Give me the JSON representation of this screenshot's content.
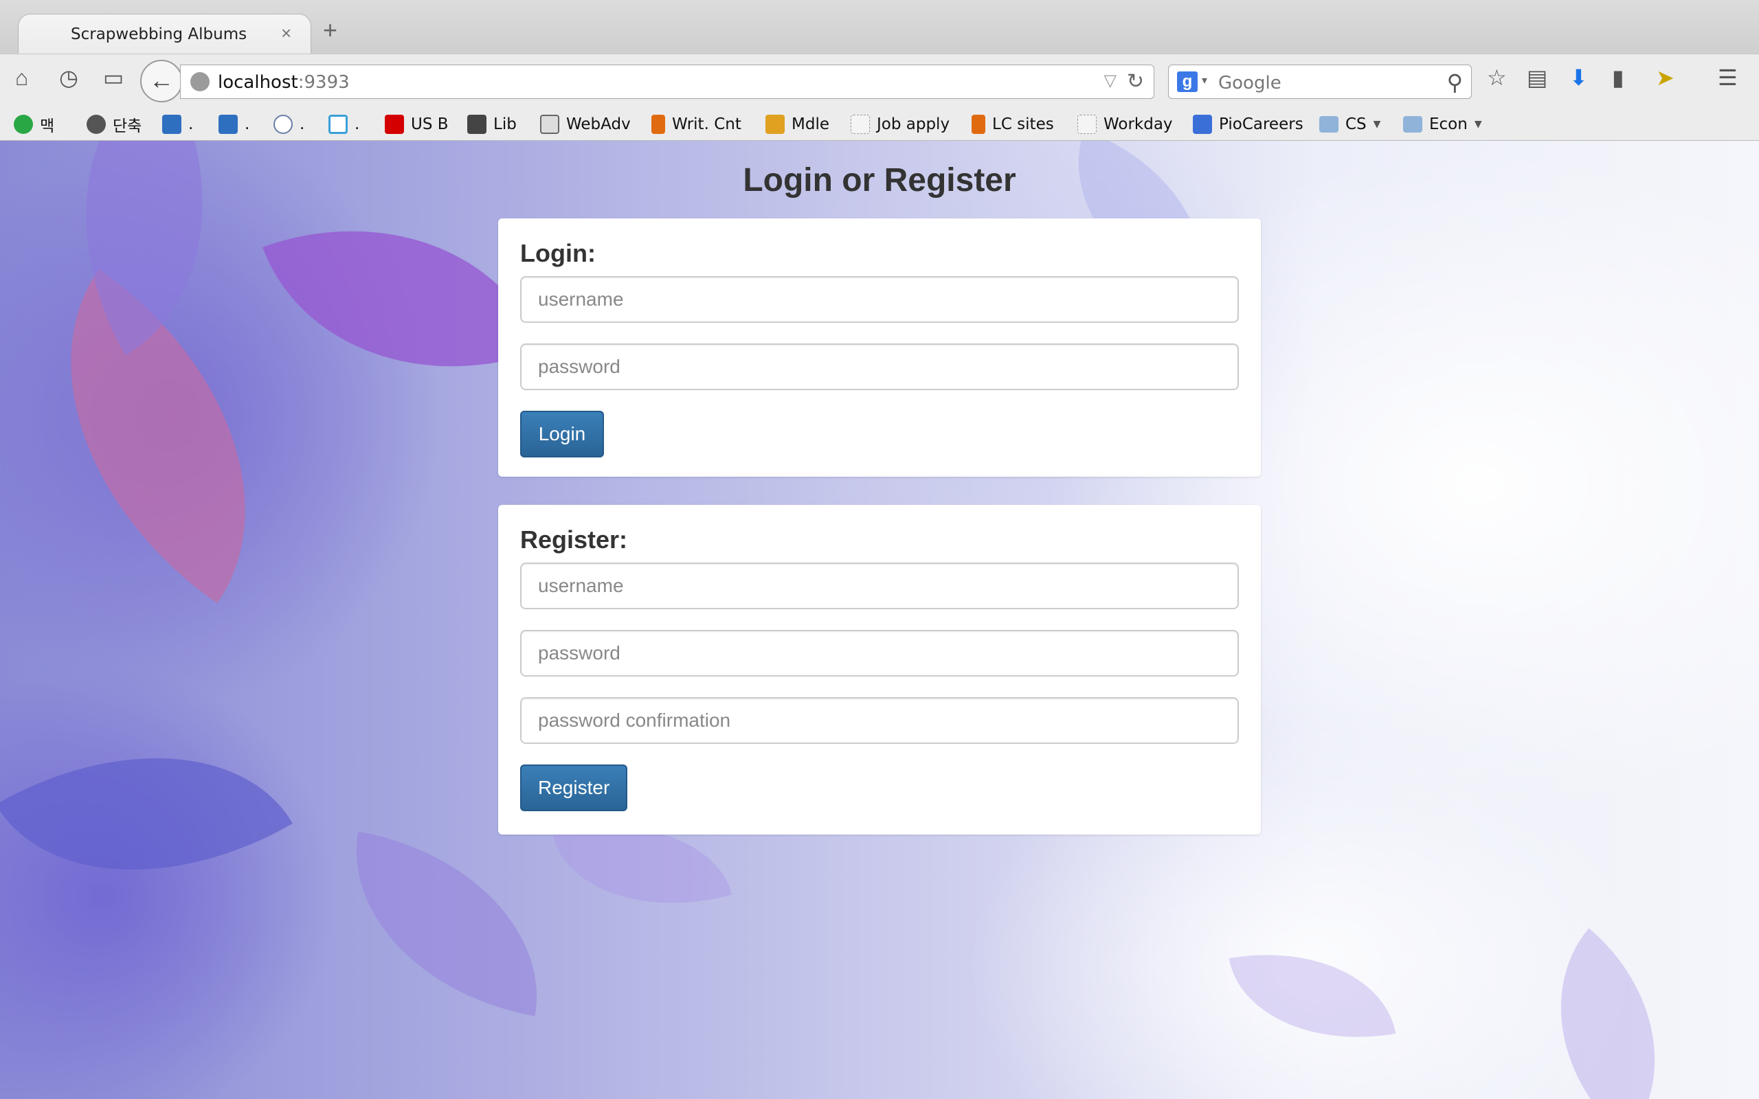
{
  "browser": {
    "tab_title": "Scrapwebbing Albums",
    "tab_close": "×",
    "new_tab": "+",
    "url_host": "localhost",
    "url_port": ":9393",
    "search_engine": "Google",
    "bookmarks": [
      {
        "label": "맥",
        "icon_color": "#2aa745"
      },
      {
        "label": "단축",
        "icon_color": "#555555"
      },
      {
        "label": ".",
        "icon_color": "#2f6fc0"
      },
      {
        "label": ".",
        "icon_color": "#2f6fc0"
      },
      {
        "label": ".",
        "icon_color": "#6b7fa8"
      },
      {
        "label": ".",
        "icon_color": "#3aa0d8"
      },
      {
        "label": "US B",
        "icon_color": "#d40000"
      },
      {
        "label": "Lib",
        "icon_color": "#444444"
      },
      {
        "label": "WebAdv",
        "icon_color": "#666666"
      },
      {
        "label": "Writ. Cnt",
        "icon_color": "#e06a10"
      },
      {
        "label": "Mdle",
        "icon_color": "#e0a020"
      },
      {
        "label": "Job apply",
        "icon_color": "#dddddd"
      },
      {
        "label": "LC sites",
        "icon_color": "#e06a10"
      },
      {
        "label": "Workday",
        "icon_color": "#dddddd"
      },
      {
        "label": "PioCareers",
        "icon_color": "#3b6fd8"
      },
      {
        "label": "CS",
        "icon_color": "#8fb3d9",
        "folder": true
      },
      {
        "label": "Econ",
        "icon_color": "#8fb3d9",
        "folder": true
      }
    ]
  },
  "page": {
    "heading": "Login or Register",
    "login": {
      "title": "Login:",
      "username_placeholder": "username",
      "password_placeholder": "password",
      "button": "Login"
    },
    "register": {
      "title": "Register:",
      "username_placeholder": "username",
      "password_placeholder": "password",
      "confirm_placeholder": "password confirmation",
      "button": "Register"
    }
  },
  "colors": {
    "primary_button": "#2a6496",
    "panel_bg": "#ffffff"
  }
}
